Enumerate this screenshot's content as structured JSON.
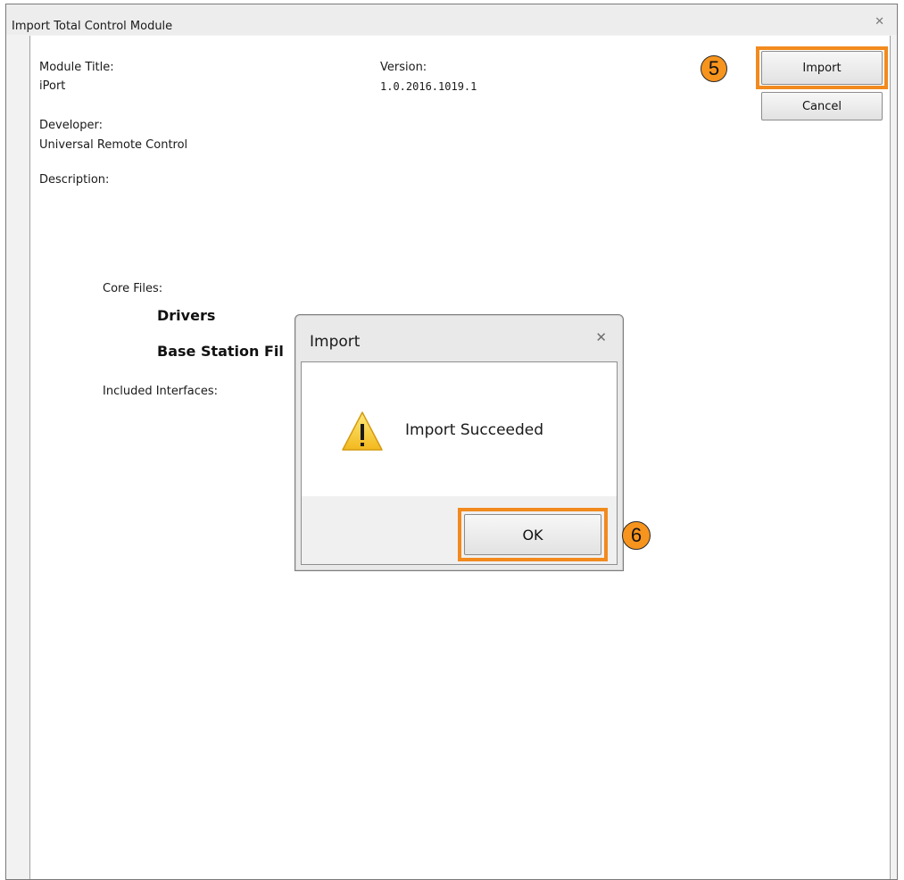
{
  "window": {
    "title": "Import Total Control Module",
    "close_glyph": "✕"
  },
  "module": {
    "title_label": "Module Title:",
    "title_value": "iPort",
    "version_label": "Version:",
    "version_value": "1.0.2016.1019.1",
    "developer_label": "Developer:",
    "developer_value": "Universal Remote Control",
    "description_label": "Description:",
    "core_files_label": "Core Files:",
    "core_files": [
      "Drivers",
      "Base Station Fil"
    ],
    "interfaces_label": "Included Interfaces:"
  },
  "buttons": {
    "import_label": "Import",
    "cancel_label": "Cancel"
  },
  "dialog": {
    "title": "Import",
    "close_glyph": "✕",
    "message": "Import Succeeded",
    "ok_label": "OK",
    "icon": "warning-icon"
  },
  "annotations": {
    "step5": "5",
    "step6": "6",
    "highlight_color": "#F28A1E"
  }
}
